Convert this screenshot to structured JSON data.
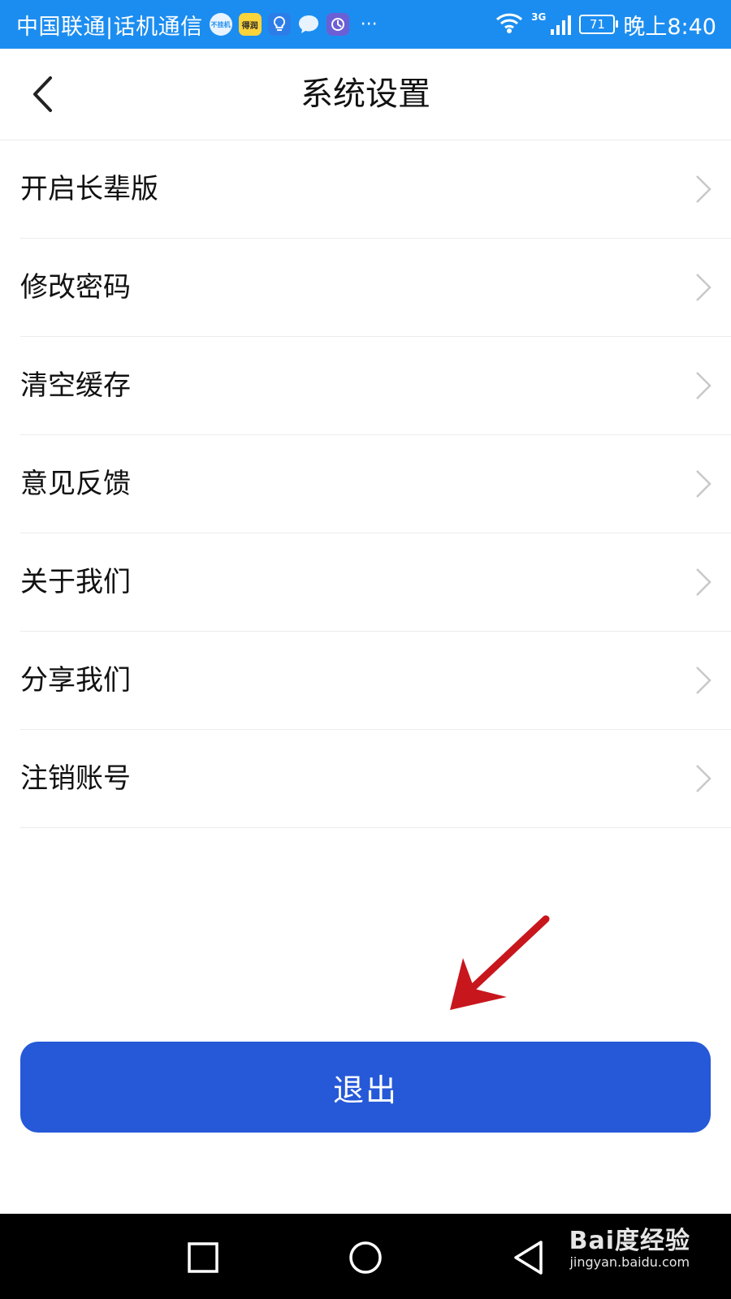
{
  "status_bar": {
    "carrier": "中国联通|话机通信",
    "network": "3G",
    "battery": "71",
    "time": "晚上8:40",
    "notif_icons": [
      {
        "name": "app-notification-icon-1",
        "glyph": "不挂机",
        "style": "round"
      },
      {
        "name": "app-notification-icon-2",
        "glyph": "得润",
        "style": "yellow"
      },
      {
        "name": "lightbulb-notification-icon",
        "glyph": "",
        "style": "blue"
      },
      {
        "name": "chat-bubble-notification-icon",
        "glyph": "",
        "style": "round"
      },
      {
        "name": "app-notification-icon-3",
        "glyph": "",
        "style": "purple"
      }
    ],
    "more": "···"
  },
  "header": {
    "title": "系统设置",
    "back_icon": "chevron-left-icon"
  },
  "settings": {
    "items": [
      {
        "label": "开启长辈版"
      },
      {
        "label": "修改密码"
      },
      {
        "label": "清空缓存"
      },
      {
        "label": "意见反馈"
      },
      {
        "label": "关于我们"
      },
      {
        "label": "分享我们"
      },
      {
        "label": "注销账号"
      }
    ],
    "chevron_icon": "chevron-right-icon"
  },
  "logout": {
    "label": "退出",
    "color": "#2659d8"
  },
  "annotation": {
    "icon": "red-arrow-icon",
    "color": "#c8161d"
  },
  "nav_bar": {
    "buttons": [
      "recent-apps-icon",
      "home-icon",
      "back-icon"
    ]
  },
  "watermark": {
    "brand": "Bai度经验",
    "url": "jingyan.baidu.com"
  },
  "colors": {
    "status_bar": "#1c8df0",
    "divider": "#ececec",
    "text": "#111111"
  }
}
